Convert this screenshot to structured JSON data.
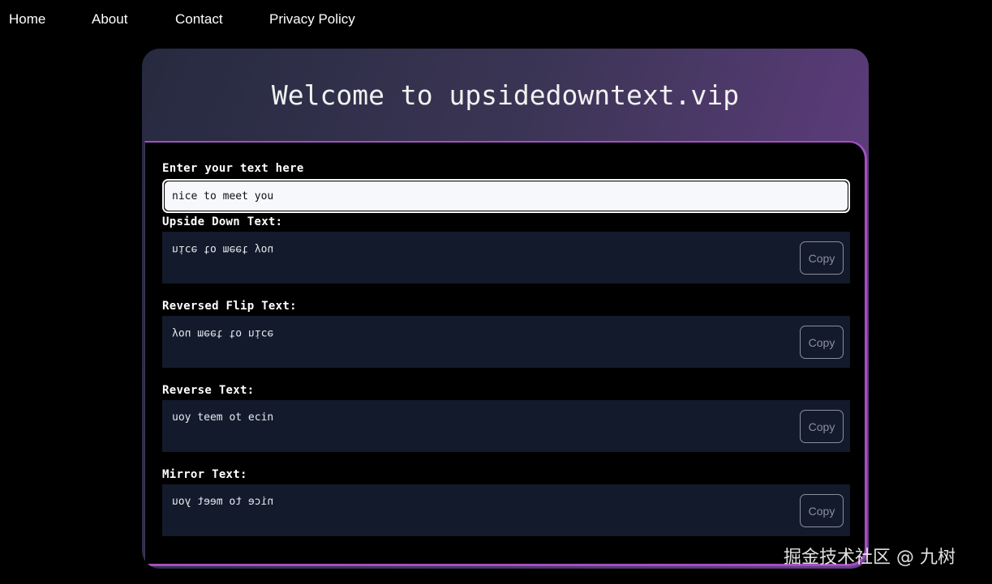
{
  "nav": {
    "items": [
      "Home",
      "About",
      "Contact",
      "Privacy Policy"
    ]
  },
  "header": {
    "title": "Welcome to upsidedowntext.vip"
  },
  "input": {
    "label": "Enter your text here",
    "value": "nice to meet you"
  },
  "outputs": [
    {
      "label": "Upside Down Text:",
      "text": "nice to meet you",
      "copy_label": "Copy"
    },
    {
      "label": "Reversed Flip Text:",
      "text": "you meet to nice",
      "copy_label": "Copy"
    },
    {
      "label": "Reverse Text:",
      "text": "uoy teem ot ecin",
      "copy_label": "Copy"
    },
    {
      "label": "Mirror Text:",
      "text": "nice to meet you",
      "copy_label": "Copy"
    }
  ],
  "watermark": "掘金技术社区 @ 九树",
  "colors": {
    "background": "#000000",
    "panel_border": "#a44fc0",
    "output_bg": "#131a2b",
    "header_gradient_end": "#6a3f8a"
  }
}
